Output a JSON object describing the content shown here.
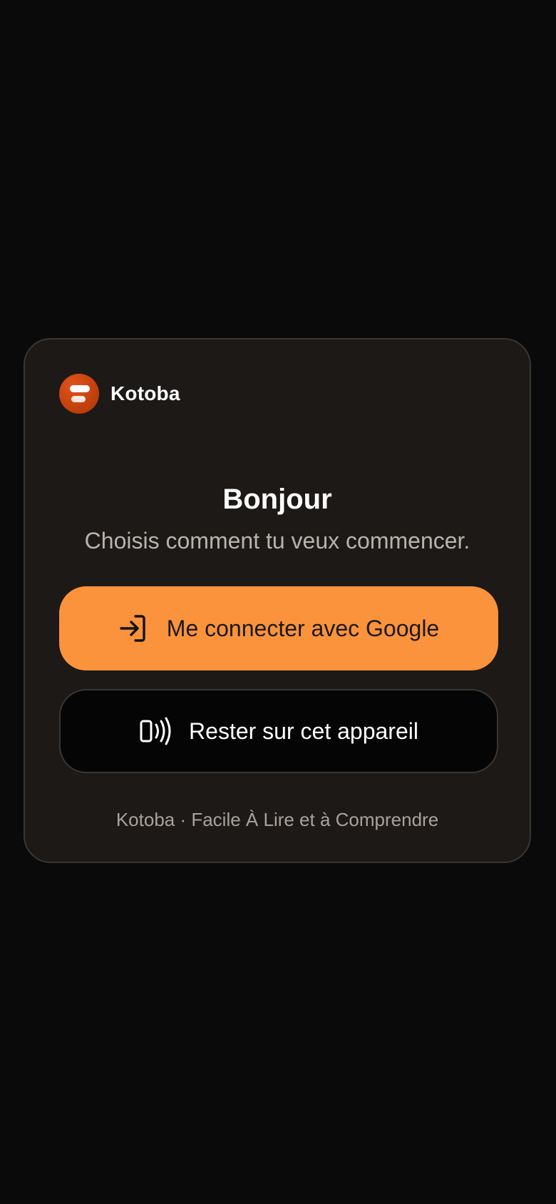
{
  "brand": {
    "name": "Kotoba",
    "logo_icon": "kotoba-logo-icon",
    "accent": "#c2410c"
  },
  "main": {
    "title": "Bonjour",
    "subtitle": "Choisis comment tu veux commencer."
  },
  "actions": {
    "google": {
      "label": "Me connecter avec Google",
      "icon": "login-arrow-icon",
      "color": "#fb923c"
    },
    "device": {
      "label": "Rester sur cet appareil",
      "icon": "device-signal-icon",
      "color": "#050505"
    }
  },
  "footer": {
    "text": "Kotoba · Facile À Lire et à Comprendre"
  }
}
